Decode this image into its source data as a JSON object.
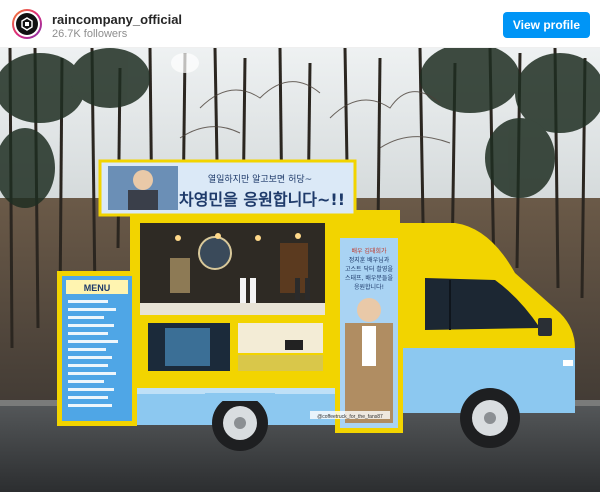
{
  "header": {
    "username": "raincompany_official",
    "followers": "26.7K followers",
    "view_profile_label": "View profile",
    "avatar_icon": "rain-company-logo-icon"
  },
  "post": {
    "truck": {
      "banner_line1": "열일하지만 알고보면 허당~",
      "banner_line2": "차영민을 응원합니다~!!",
      "side_board_lines": [
        "배우 김태희가",
        "정지훈 배우님과",
        "고스트 닥터 촬영을",
        "스태프, 배우분들을",
        "응원합니다!"
      ],
      "menu_board_title": "MENU",
      "plate_text": "@coffeetruck_for_the_fans87"
    }
  },
  "colors": {
    "button_blue": "#0095f6",
    "truck_yellow": "#f2d400",
    "truck_sky_blue": "#8cc8f0"
  }
}
